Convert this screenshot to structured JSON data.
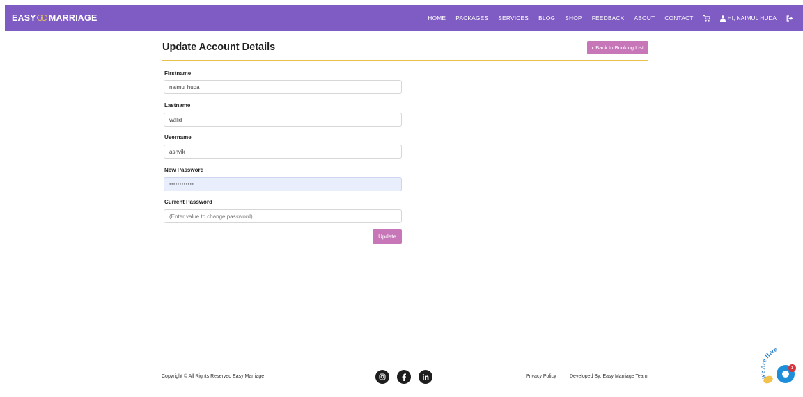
{
  "brand": {
    "left": "EASY",
    "right": "MARRIAGE"
  },
  "nav": {
    "items": [
      "HOME",
      "PACKAGES",
      "SERVICES",
      "BLOG",
      "SHOP",
      "FEEDBACK",
      "ABOUT",
      "CONTACT"
    ],
    "user_greeting": "HI, NAIMUL HUDA",
    "icons": [
      "cart-icon",
      "user-icon",
      "logout-icon"
    ]
  },
  "page": {
    "title": "Update Account Details",
    "back_button": "Back to Booking List"
  },
  "form": {
    "firstname": {
      "label": "Firstname",
      "value": "naimul huda"
    },
    "lastname": {
      "label": "Lastname",
      "value": "walid"
    },
    "username": {
      "label": "Username",
      "value": "ashvik"
    },
    "new_password": {
      "label": "New Password",
      "value": "••••••••••••"
    },
    "current_password": {
      "label": "Current Password",
      "placeholder": "(Enter value to change password)"
    },
    "update_button": "Update"
  },
  "footer": {
    "copyright": "Copyright © All Rights Reserved Easy Marriage",
    "social": [
      "instagram-icon",
      "facebook-icon",
      "linkedin-icon"
    ],
    "privacy": "Privacy Policy",
    "developed": "Developed By: Easy Marriage Team"
  },
  "chat": {
    "label": "We Are Here",
    "badge": "1"
  },
  "colors": {
    "navbar": "#7f5bc4",
    "accent_button": "#c777b8",
    "title_underline": "#e8c14a",
    "chat": "#1d8fd9"
  }
}
